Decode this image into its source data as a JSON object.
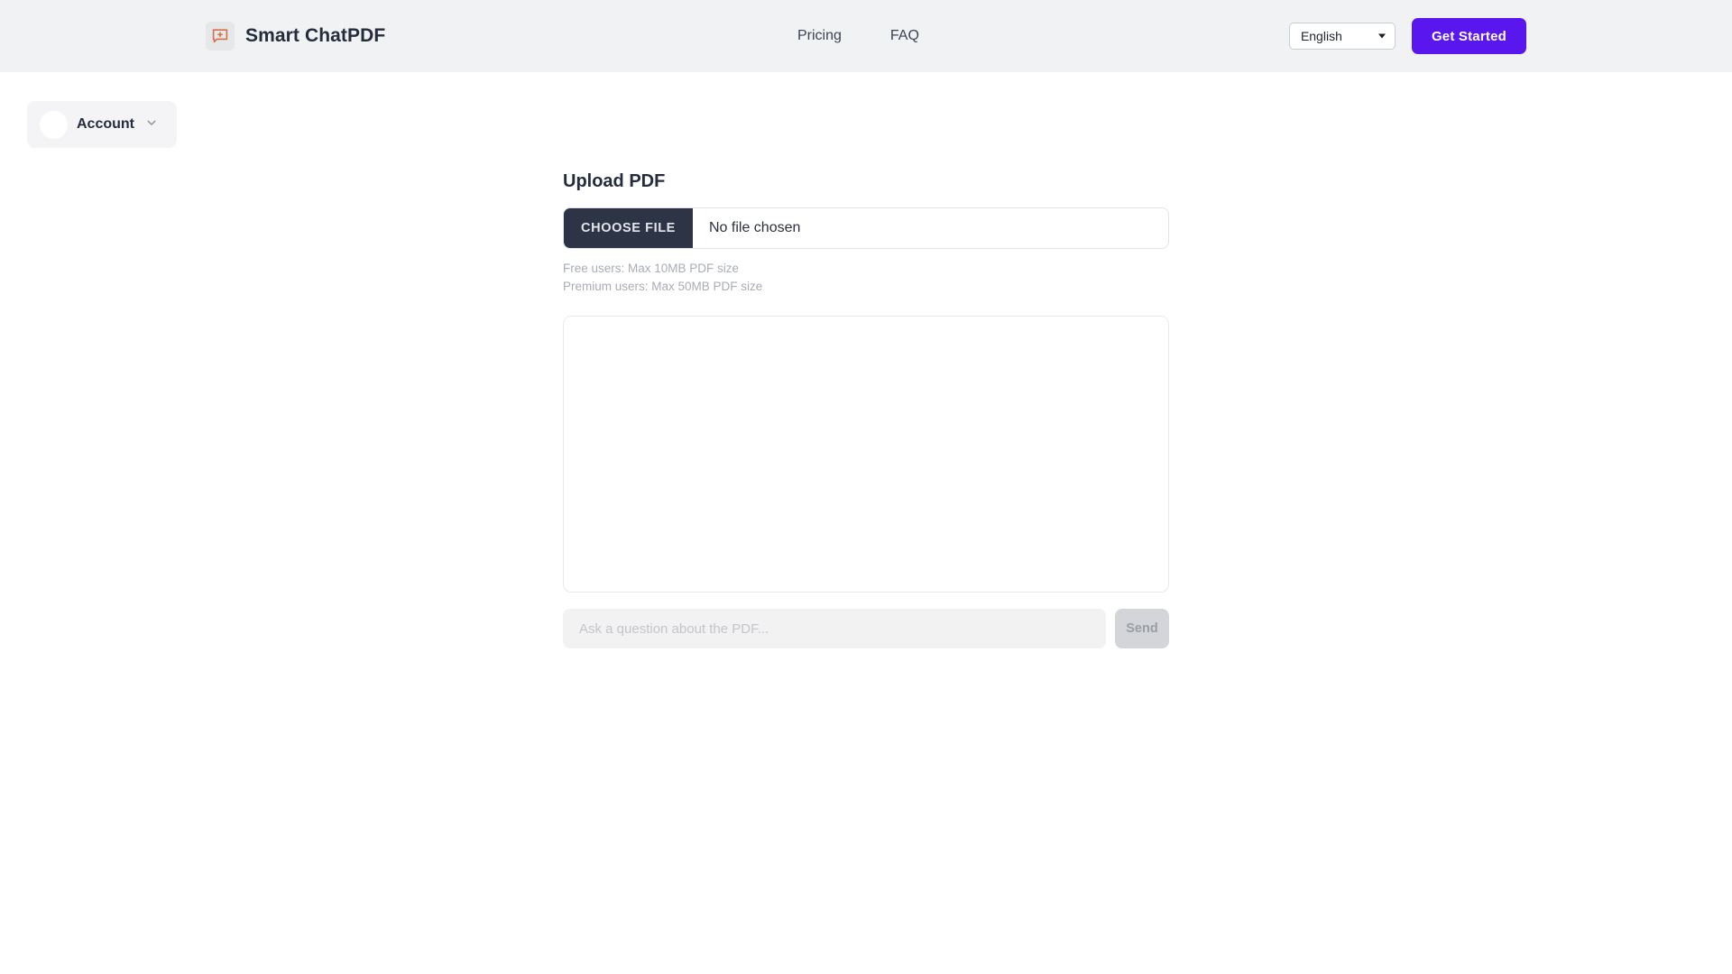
{
  "header": {
    "brand": {
      "name": "Smart ChatPDF",
      "icon": "chat-bubble-plus-icon",
      "icon_color": "#d3714c",
      "icon_bg": "#e6e7e9"
    },
    "nav": [
      {
        "label": "Pricing"
      },
      {
        "label": "FAQ"
      }
    ],
    "language": {
      "selected": "English",
      "options": [
        "English"
      ],
      "caret_icon": "caret-down-icon"
    },
    "cta": {
      "label": "Get Started",
      "color": "#5a16ef"
    },
    "background": "#f1f2f3"
  },
  "account": {
    "label": "Account",
    "avatar_icon": "avatar-placeholder-icon",
    "chevron_icon": "chevron-down-icon"
  },
  "main": {
    "title": "Upload PDF",
    "file_input": {
      "button_label": "CHOOSE FILE",
      "status": "No file chosen",
      "button_color": "#2c3445"
    },
    "limits": [
      "Free users: Max 10MB PDF size",
      "Premium users: Max 50MB PDF size"
    ],
    "chat": {
      "messages": [],
      "empty": ""
    },
    "composer": {
      "value": "",
      "placeholder": "Ask a question about the PDF...",
      "send_label": "Send",
      "send_disabled": true
    }
  }
}
